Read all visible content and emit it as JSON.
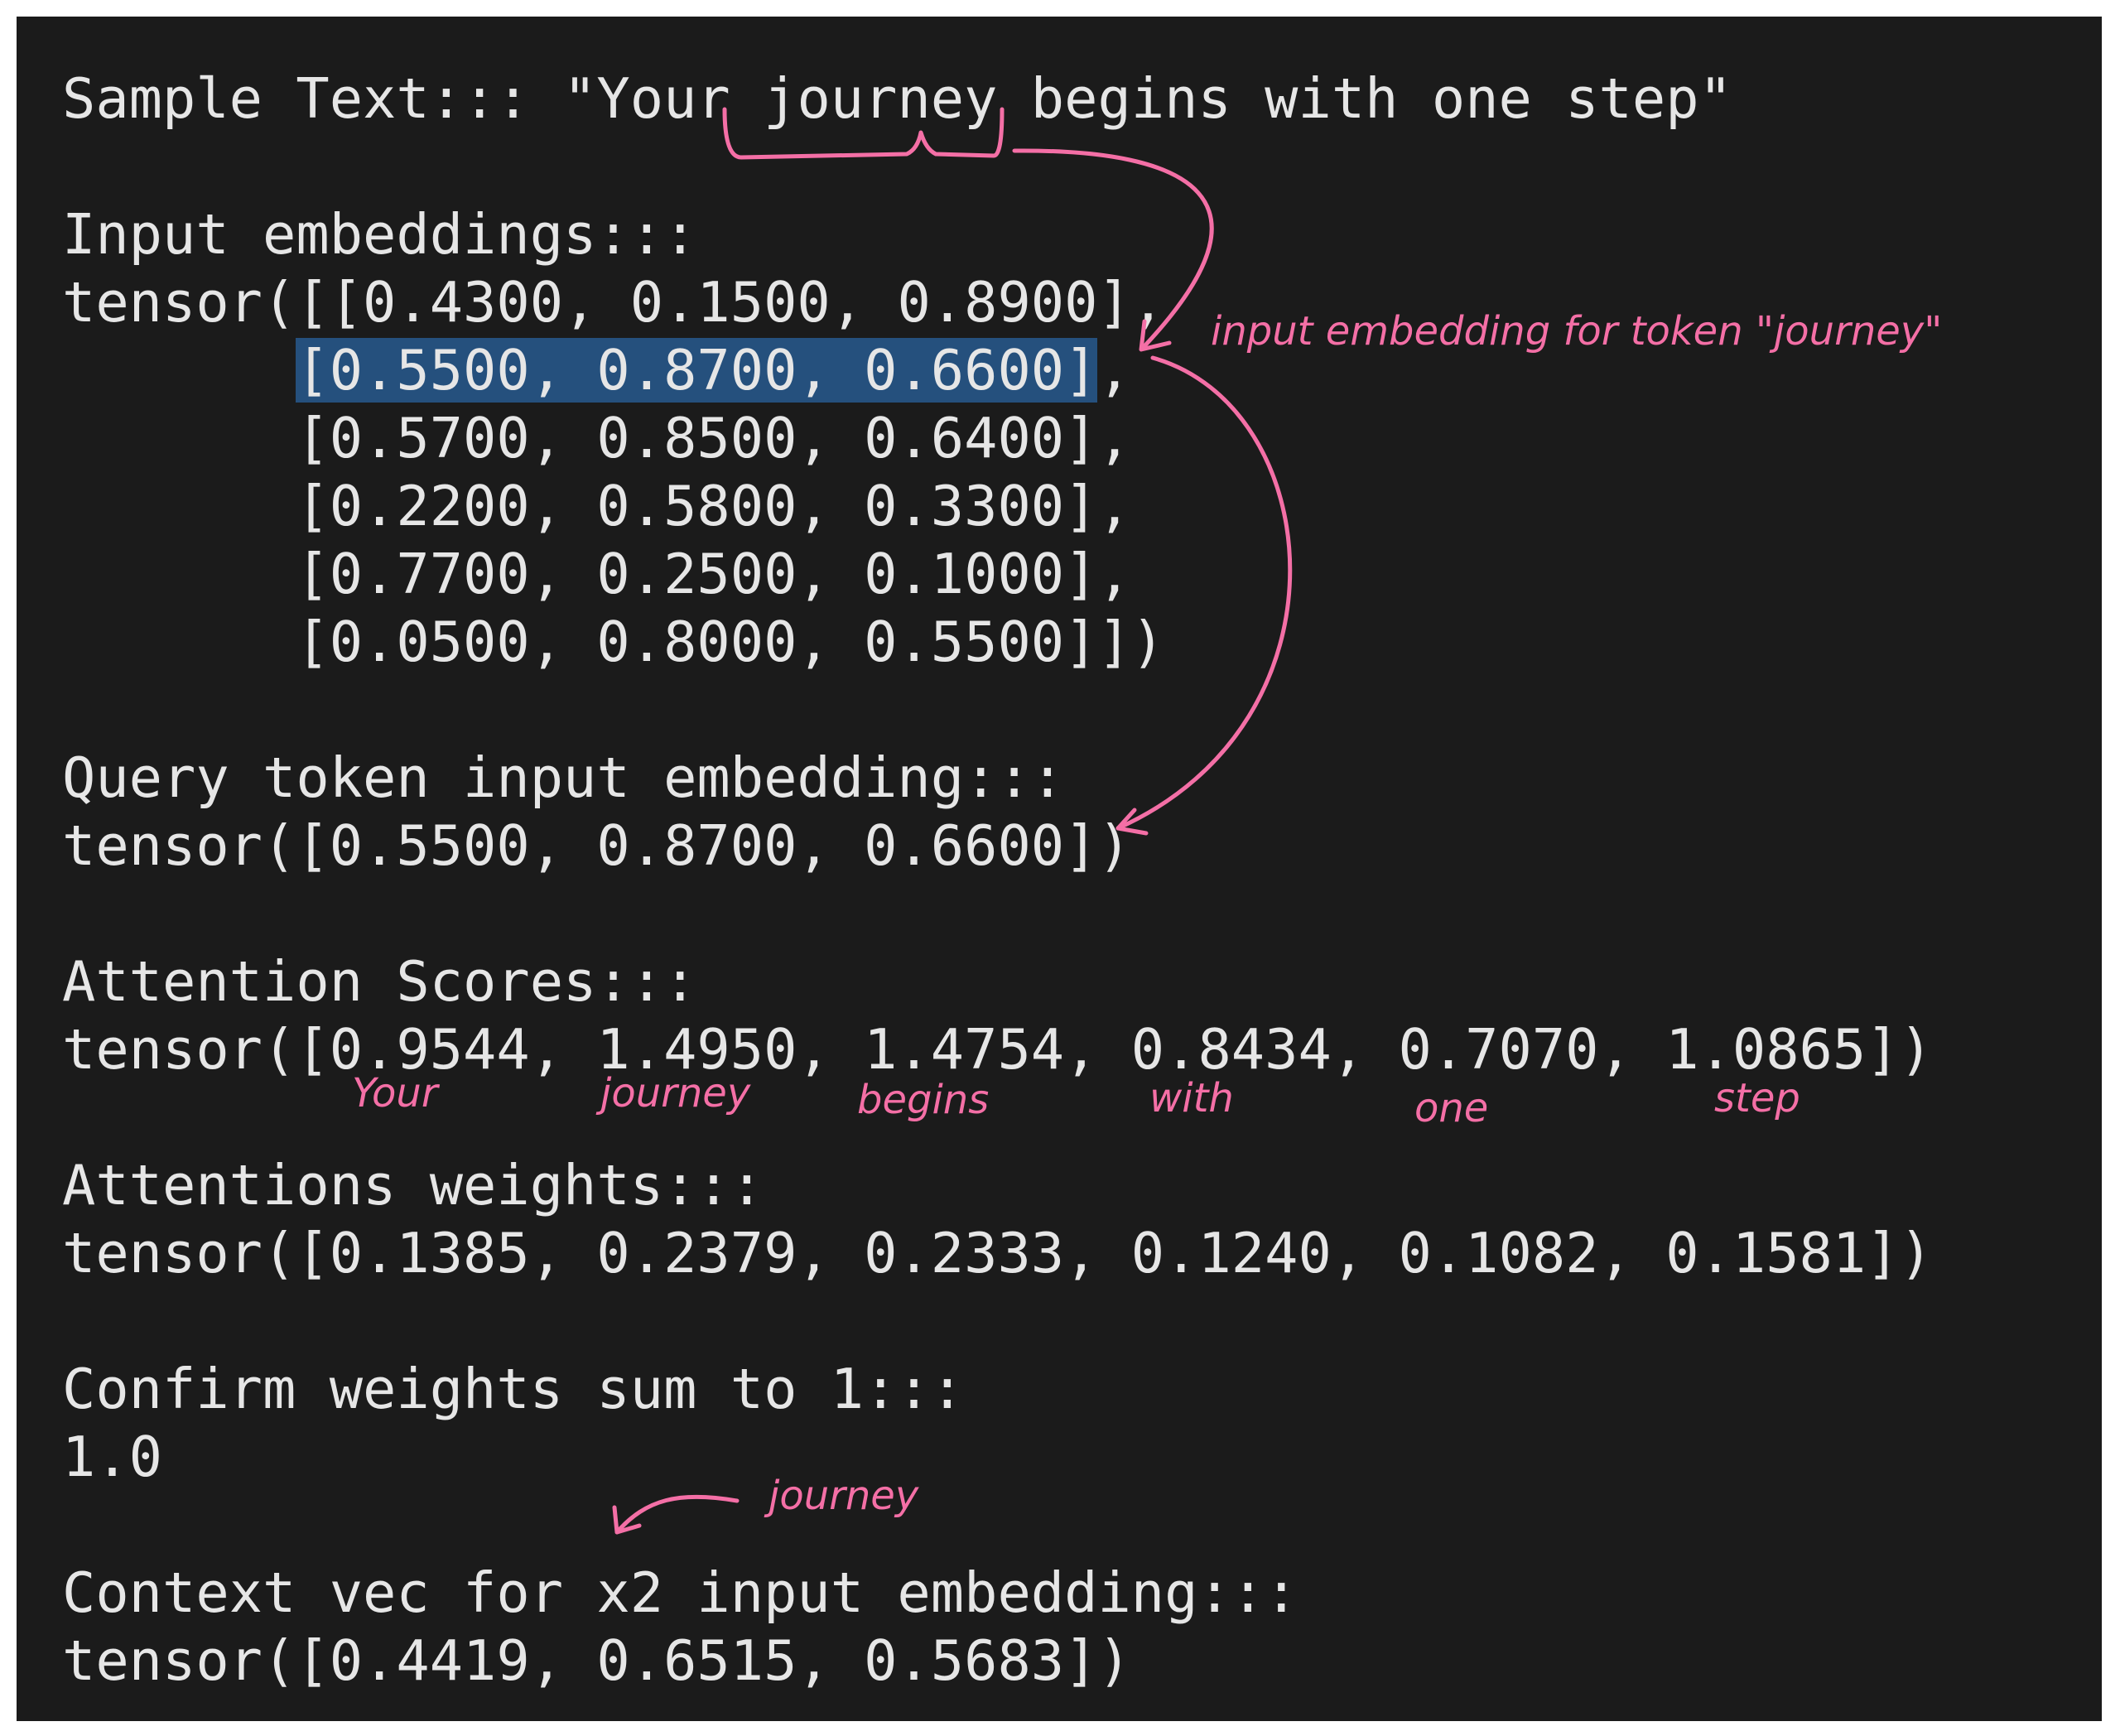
{
  "terminal": {
    "sample": {
      "label": "Sample Text:::",
      "text": "\"Your journey begins with one step\""
    },
    "input_embeddings": {
      "label": "Input embeddings:::",
      "open": "tensor([",
      "indent": "       ",
      "rows": [
        "[0.4300, 0.1500, 0.8900]",
        "[0.5500, 0.8700, 0.6600]",
        "[0.5700, 0.8500, 0.6400]",
        "[0.2200, 0.5800, 0.3300]",
        "[0.7700, 0.2500, 0.1000]",
        "[0.0500, 0.8000, 0.5500]"
      ],
      "row_sep": ",",
      "close": "])"
    },
    "query": {
      "label": "Query token input embedding:::",
      "value": "tensor([0.5500, 0.8700, 0.6600])"
    },
    "scores": {
      "label": "Attention Scores:::",
      "value": "tensor([0.9544, 1.4950, 1.4754, 0.8434, 0.7070, 1.0865])"
    },
    "weights": {
      "label": "Attentions weights:::",
      "value": "tensor([0.1385, 0.2379, 0.2333, 0.1240, 0.1082, 0.1581])"
    },
    "confirm": {
      "label": "Confirm weights sum to 1:::",
      "value": "1.0"
    },
    "context": {
      "label": "Context vec for x2 input embedding:::",
      "value": "tensor([0.4419, 0.6515, 0.5683])"
    }
  },
  "annotations": {
    "journey_note": "input embedding for token \"journey\"",
    "tokens": [
      "Your",
      "journey",
      "begins",
      "with",
      "one",
      "step"
    ],
    "x2_note": "journey",
    "color": "#f46fa6"
  },
  "highlight_color": "#25507d"
}
